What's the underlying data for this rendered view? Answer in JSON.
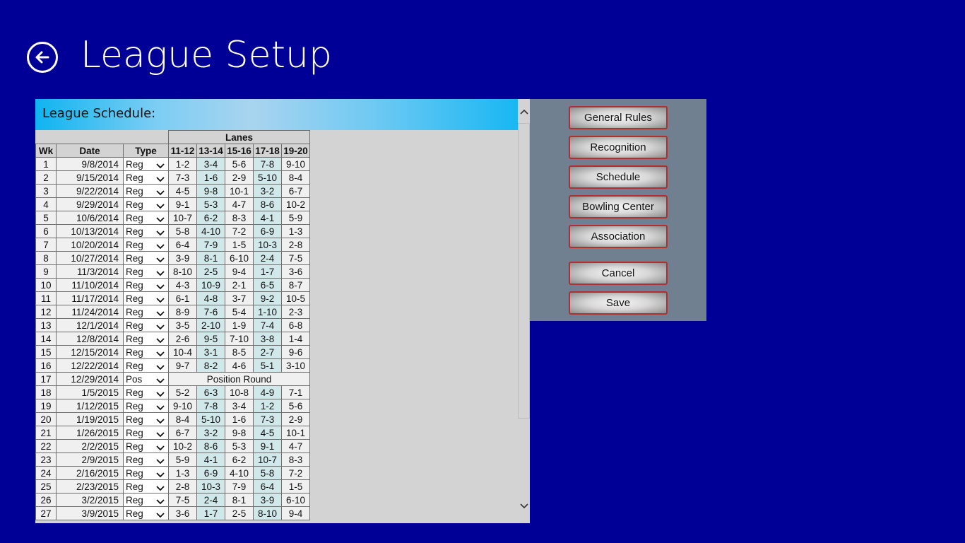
{
  "page": {
    "title": "League Setup"
  },
  "schedule": {
    "header": "League Schedule:",
    "lanes_header": "Lanes",
    "columns": [
      "Wk",
      "Date",
      "Type",
      "11-12",
      "13-14",
      "15-16",
      "17-18",
      "19-20"
    ],
    "position_round_label": "Position Round",
    "rows": [
      {
        "wk": "1",
        "date": "9/8/2014",
        "type": "Reg",
        "lanes": [
          "1-2",
          "3-4",
          "5-6",
          "7-8",
          "9-10"
        ]
      },
      {
        "wk": "2",
        "date": "9/15/2014",
        "type": "Reg",
        "lanes": [
          "7-3",
          "1-6",
          "2-9",
          "5-10",
          "8-4"
        ]
      },
      {
        "wk": "3",
        "date": "9/22/2014",
        "type": "Reg",
        "lanes": [
          "4-5",
          "9-8",
          "10-1",
          "3-2",
          "6-7"
        ]
      },
      {
        "wk": "4",
        "date": "9/29/2014",
        "type": "Reg",
        "lanes": [
          "9-1",
          "5-3",
          "4-7",
          "8-6",
          "10-2"
        ]
      },
      {
        "wk": "5",
        "date": "10/6/2014",
        "type": "Reg",
        "lanes": [
          "10-7",
          "6-2",
          "8-3",
          "4-1",
          "5-9"
        ]
      },
      {
        "wk": "6",
        "date": "10/13/2014",
        "type": "Reg",
        "lanes": [
          "5-8",
          "4-10",
          "7-2",
          "6-9",
          "1-3"
        ]
      },
      {
        "wk": "7",
        "date": "10/20/2014",
        "type": "Reg",
        "lanes": [
          "6-4",
          "7-9",
          "1-5",
          "10-3",
          "2-8"
        ]
      },
      {
        "wk": "8",
        "date": "10/27/2014",
        "type": "Reg",
        "lanes": [
          "3-9",
          "8-1",
          "6-10",
          "2-4",
          "7-5"
        ]
      },
      {
        "wk": "9",
        "date": "11/3/2014",
        "type": "Reg",
        "lanes": [
          "8-10",
          "2-5",
          "9-4",
          "1-7",
          "3-6"
        ]
      },
      {
        "wk": "10",
        "date": "11/10/2014",
        "type": "Reg",
        "lanes": [
          "4-3",
          "10-9",
          "2-1",
          "6-5",
          "8-7"
        ]
      },
      {
        "wk": "11",
        "date": "11/17/2014",
        "type": "Reg",
        "lanes": [
          "6-1",
          "4-8",
          "3-7",
          "9-2",
          "10-5"
        ]
      },
      {
        "wk": "12",
        "date": "11/24/2014",
        "type": "Reg",
        "lanes": [
          "8-9",
          "7-6",
          "5-4",
          "1-10",
          "2-3"
        ]
      },
      {
        "wk": "13",
        "date": "12/1/2014",
        "type": "Reg",
        "lanes": [
          "3-5",
          "2-10",
          "1-9",
          "7-4",
          "6-8"
        ]
      },
      {
        "wk": "14",
        "date": "12/8/2014",
        "type": "Reg",
        "lanes": [
          "2-6",
          "9-5",
          "7-10",
          "3-8",
          "1-4"
        ]
      },
      {
        "wk": "15",
        "date": "12/15/2014",
        "type": "Reg",
        "lanes": [
          "10-4",
          "3-1",
          "8-5",
          "2-7",
          "9-6"
        ]
      },
      {
        "wk": "16",
        "date": "12/22/2014",
        "type": "Reg",
        "lanes": [
          "9-7",
          "8-2",
          "4-6",
          "5-1",
          "3-10"
        ]
      },
      {
        "wk": "17",
        "date": "12/29/2014",
        "type": "Pos",
        "lanes": []
      },
      {
        "wk": "18",
        "date": "1/5/2015",
        "type": "Reg",
        "lanes": [
          "5-2",
          "6-3",
          "10-8",
          "4-9",
          "7-1"
        ]
      },
      {
        "wk": "19",
        "date": "1/12/2015",
        "type": "Reg",
        "lanes": [
          "9-10",
          "7-8",
          "3-4",
          "1-2",
          "5-6"
        ]
      },
      {
        "wk": "20",
        "date": "1/19/2015",
        "type": "Reg",
        "lanes": [
          "8-4",
          "5-10",
          "1-6",
          "7-3",
          "2-9"
        ]
      },
      {
        "wk": "21",
        "date": "1/26/2015",
        "type": "Reg",
        "lanes": [
          "6-7",
          "3-2",
          "9-8",
          "4-5",
          "10-1"
        ]
      },
      {
        "wk": "22",
        "date": "2/2/2015",
        "type": "Reg",
        "lanes": [
          "10-2",
          "8-6",
          "5-3",
          "9-1",
          "4-7"
        ]
      },
      {
        "wk": "23",
        "date": "2/9/2015",
        "type": "Reg",
        "lanes": [
          "5-9",
          "4-1",
          "6-2",
          "10-7",
          "8-3"
        ]
      },
      {
        "wk": "24",
        "date": "2/16/2015",
        "type": "Reg",
        "lanes": [
          "1-3",
          "6-9",
          "4-10",
          "5-8",
          "7-2"
        ]
      },
      {
        "wk": "25",
        "date": "2/23/2015",
        "type": "Reg",
        "lanes": [
          "2-8",
          "10-3",
          "7-9",
          "6-4",
          "1-5"
        ]
      },
      {
        "wk": "26",
        "date": "3/2/2015",
        "type": "Reg",
        "lanes": [
          "7-5",
          "2-4",
          "8-1",
          "3-9",
          "6-10"
        ]
      },
      {
        "wk": "27",
        "date": "3/9/2015",
        "type": "Reg",
        "lanes": [
          "3-6",
          "1-7",
          "2-5",
          "8-10",
          "9-4"
        ]
      }
    ]
  },
  "sidebar": {
    "buttons": [
      "General Rules",
      "Recognition",
      "Schedule",
      "Bowling Center",
      "Association"
    ],
    "cancel": "Cancel",
    "save": "Save"
  },
  "icons": {
    "back": "back-arrow-icon",
    "scroll_up": "chevron-up-icon",
    "scroll_down": "chevron-down-icon",
    "dropdown": "chevron-down-icon"
  },
  "colors": {
    "background": "#000096",
    "header_accent": "#0fb4f0",
    "sidebar_bg": "#708090",
    "button_border": "#b03030",
    "lane_highlight": "#d0e8ea"
  }
}
